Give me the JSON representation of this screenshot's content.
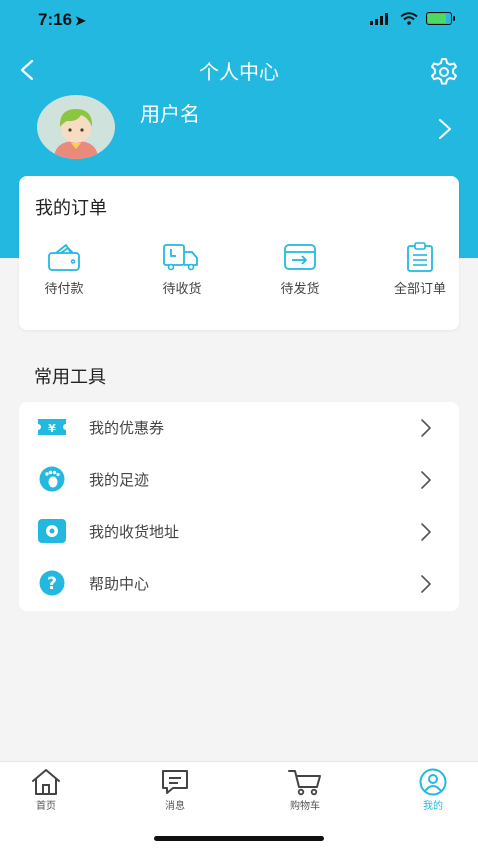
{
  "status_bar": {
    "time": "7:16"
  },
  "nav": {
    "title": "个人中心"
  },
  "profile": {
    "username": "用户名"
  },
  "orders": {
    "title": "我的订单",
    "items": [
      {
        "label": "待付款",
        "icon": "wallet-icon"
      },
      {
        "label": "待收货",
        "icon": "delivery-truck-icon"
      },
      {
        "label": "待发货",
        "icon": "package-send-icon"
      },
      {
        "label": "全部订单",
        "icon": "clipboard-list-icon"
      }
    ]
  },
  "tools": {
    "title": "常用工具",
    "items": [
      {
        "label": "我的优惠券",
        "icon": "coupon-icon"
      },
      {
        "label": "我的足迹",
        "icon": "footprint-icon"
      },
      {
        "label": "我的收货地址",
        "icon": "address-icon"
      },
      {
        "label": "帮助中心",
        "icon": "help-icon"
      }
    ]
  },
  "tabbar": {
    "items": [
      {
        "label": "首页",
        "icon": "home-icon"
      },
      {
        "label": "消息",
        "icon": "message-icon"
      },
      {
        "label": "购物车",
        "icon": "cart-icon"
      },
      {
        "label": "我的",
        "icon": "profile-icon",
        "active": true
      }
    ]
  },
  "colors": {
    "primary": "#23b8e0",
    "background": "#f4f4f4",
    "card": "#ffffff"
  }
}
